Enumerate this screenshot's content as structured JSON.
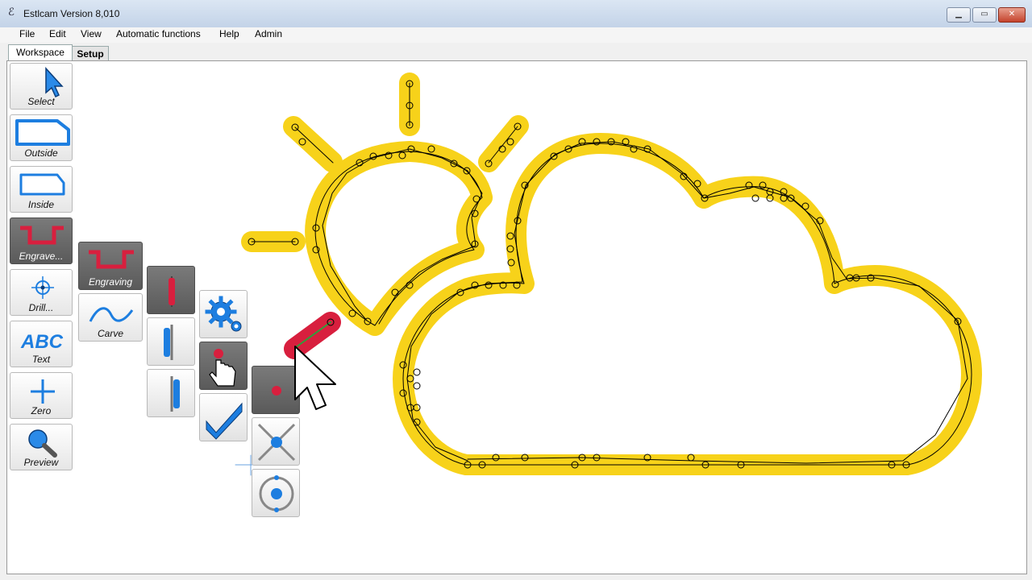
{
  "window": {
    "title": "Estlcam Version 8,010"
  },
  "menu": {
    "items": [
      "File",
      "Edit",
      "View",
      "Automatic functions",
      "Help",
      "Admin"
    ]
  },
  "tabs": {
    "workspace": "Workspace",
    "setup": "Setup"
  },
  "tools": {
    "select": "Select",
    "outside": "Outside",
    "inside": "Inside",
    "engrave": "Engrave...",
    "drill": "Drill...",
    "text": "Text",
    "zero": "Zero",
    "preview": "Preview"
  },
  "engrave_menu": {
    "engraving": "Engraving",
    "carve": "Carve"
  },
  "colors": {
    "highlight": "#f7d21a",
    "selected": "#d81f3e",
    "accent": "#1d7ee0",
    "path": "#000000"
  }
}
